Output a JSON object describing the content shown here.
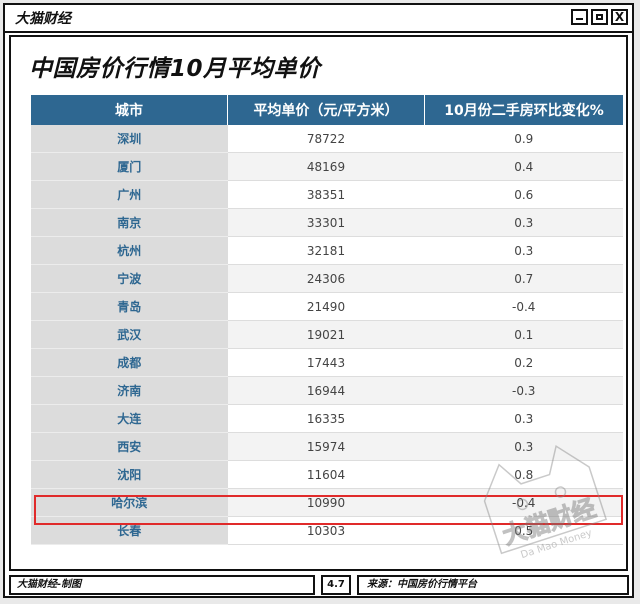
{
  "window": {
    "app_title": "大猫财经",
    "min_label": "",
    "max_label": "",
    "close_label": "X"
  },
  "heading": "中国房价行情10月平均单价",
  "table": {
    "headers": [
      "城市",
      "平均单价（元/平方米）",
      "10月份二手房环比变化%"
    ],
    "rows": [
      [
        "深圳",
        "78722",
        "0.9"
      ],
      [
        "厦门",
        "48169",
        "0.4"
      ],
      [
        "广州",
        "38351",
        "0.6"
      ],
      [
        "南京",
        "33301",
        "0.3"
      ],
      [
        "杭州",
        "32181",
        "0.3"
      ],
      [
        "宁波",
        "24306",
        "0.7"
      ],
      [
        "青岛",
        "21490",
        "-0.4"
      ],
      [
        "武汉",
        "19021",
        "0.1"
      ],
      [
        "成都",
        "17443",
        "0.2"
      ],
      [
        "济南",
        "16944",
        "-0.3"
      ],
      [
        "大连",
        "16335",
        "0.3"
      ],
      [
        "西安",
        "15974",
        "0.3"
      ],
      [
        "沈阳",
        "11604",
        "0.8"
      ],
      [
        "哈尔滨",
        "10990",
        "-0.4"
      ],
      [
        "长春",
        "10303",
        "0.5"
      ]
    ],
    "highlighted_row": 13,
    "colors": {
      "header_bg": "#2e6791",
      "city_text": "#2e6791",
      "highlight_border": "#e02a2a"
    }
  },
  "watermark": {
    "text": "大猫财经",
    "subtext": "Da Mao Money"
  },
  "footer": {
    "credit": "大猫财经-制图",
    "version": "4.7",
    "source": "来源：中国房价行情平台"
  }
}
